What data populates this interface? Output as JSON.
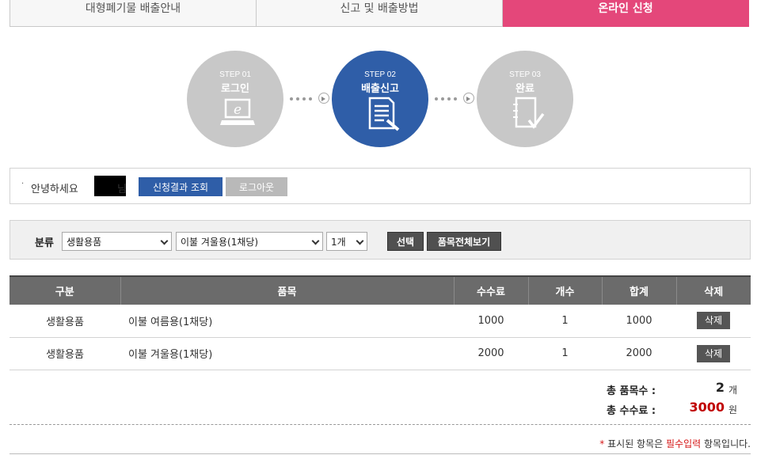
{
  "tabs": [
    {
      "label": "대형폐기물 배출안내"
    },
    {
      "label": "신고 및 배출방법"
    },
    {
      "label": "온라인 신청"
    }
  ],
  "steps": [
    {
      "num": "STEP 01",
      "title": "로그인",
      "icon": "laptop-icon"
    },
    {
      "num": "STEP 02",
      "title": "배출신고",
      "icon": "document-icon"
    },
    {
      "num": "STEP 03",
      "title": "완료",
      "icon": "notebook-check-icon"
    }
  ],
  "greeting": {
    "bullet": "·",
    "hello": "안녕하세요",
    "suffix": "님",
    "result_btn": "신청결과 조회",
    "logout_btn": "로그아웃"
  },
  "filter": {
    "label": "분류",
    "category": "생활용품",
    "item": "이불 겨울용(1채당)",
    "count": "1개",
    "select_btn": "선택",
    "view_all_btn": "품목전체보기"
  },
  "table": {
    "headers": [
      "구분",
      "품목",
      "수수료",
      "개수",
      "합계",
      "삭제"
    ],
    "rows": [
      {
        "category": "생활용품",
        "item": "이불 여름용(1채당)",
        "fee": "1000",
        "count": "1",
        "total": "1000",
        "delete": "삭제"
      },
      {
        "category": "생활용품",
        "item": "이불 겨울용(1채당)",
        "fee": "2000",
        "count": "1",
        "total": "2000",
        "delete": "삭제"
      }
    ]
  },
  "totals": {
    "items_label": "총 품목수 :",
    "items_value": "2",
    "items_unit": "개",
    "fee_label": "총 수수료 :",
    "fee_value": "3000",
    "fee_unit": "원"
  },
  "note": {
    "star": "*",
    "pre": " 표시된 항목은 ",
    "required": "필수입력",
    "post": " 항목입니다."
  },
  "colors": {
    "accent": "#e4477a",
    "primary": "#2f5ea8",
    "fee": "#c00000"
  }
}
